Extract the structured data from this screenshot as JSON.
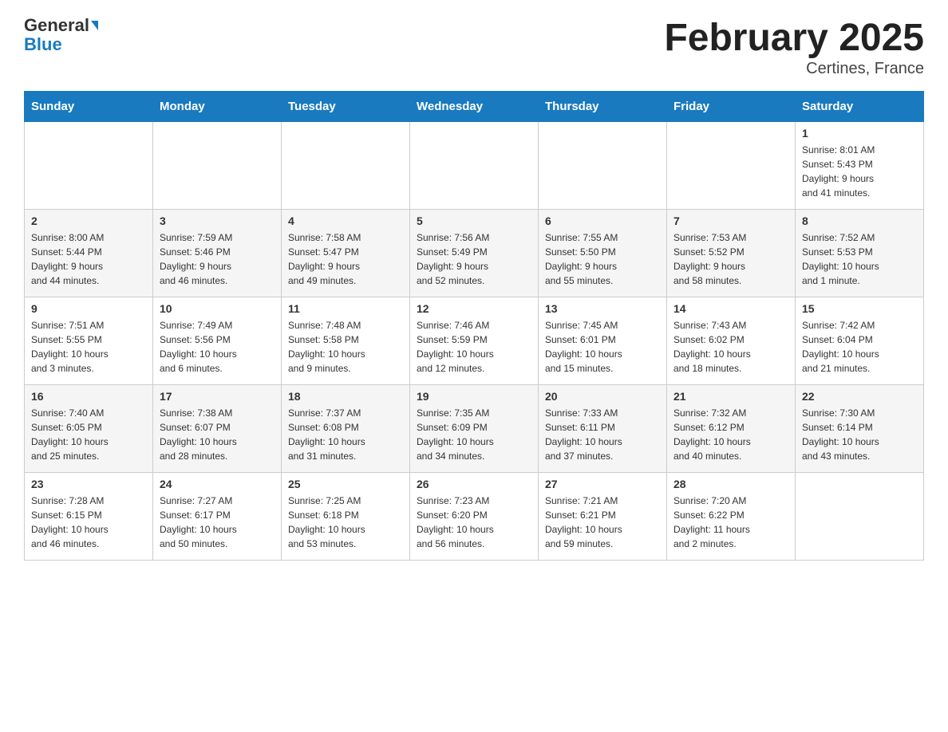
{
  "logo": {
    "text_general": "General",
    "text_blue": "Blue"
  },
  "title": "February 2025",
  "subtitle": "Certines, France",
  "weekdays": [
    "Sunday",
    "Monday",
    "Tuesday",
    "Wednesday",
    "Thursday",
    "Friday",
    "Saturday"
  ],
  "weeks": [
    [
      {
        "day": "",
        "info": ""
      },
      {
        "day": "",
        "info": ""
      },
      {
        "day": "",
        "info": ""
      },
      {
        "day": "",
        "info": ""
      },
      {
        "day": "",
        "info": ""
      },
      {
        "day": "",
        "info": ""
      },
      {
        "day": "1",
        "info": "Sunrise: 8:01 AM\nSunset: 5:43 PM\nDaylight: 9 hours\nand 41 minutes."
      }
    ],
    [
      {
        "day": "2",
        "info": "Sunrise: 8:00 AM\nSunset: 5:44 PM\nDaylight: 9 hours\nand 44 minutes."
      },
      {
        "day": "3",
        "info": "Sunrise: 7:59 AM\nSunset: 5:46 PM\nDaylight: 9 hours\nand 46 minutes."
      },
      {
        "day": "4",
        "info": "Sunrise: 7:58 AM\nSunset: 5:47 PM\nDaylight: 9 hours\nand 49 minutes."
      },
      {
        "day": "5",
        "info": "Sunrise: 7:56 AM\nSunset: 5:49 PM\nDaylight: 9 hours\nand 52 minutes."
      },
      {
        "day": "6",
        "info": "Sunrise: 7:55 AM\nSunset: 5:50 PM\nDaylight: 9 hours\nand 55 minutes."
      },
      {
        "day": "7",
        "info": "Sunrise: 7:53 AM\nSunset: 5:52 PM\nDaylight: 9 hours\nand 58 minutes."
      },
      {
        "day": "8",
        "info": "Sunrise: 7:52 AM\nSunset: 5:53 PM\nDaylight: 10 hours\nand 1 minute."
      }
    ],
    [
      {
        "day": "9",
        "info": "Sunrise: 7:51 AM\nSunset: 5:55 PM\nDaylight: 10 hours\nand 3 minutes."
      },
      {
        "day": "10",
        "info": "Sunrise: 7:49 AM\nSunset: 5:56 PM\nDaylight: 10 hours\nand 6 minutes."
      },
      {
        "day": "11",
        "info": "Sunrise: 7:48 AM\nSunset: 5:58 PM\nDaylight: 10 hours\nand 9 minutes."
      },
      {
        "day": "12",
        "info": "Sunrise: 7:46 AM\nSunset: 5:59 PM\nDaylight: 10 hours\nand 12 minutes."
      },
      {
        "day": "13",
        "info": "Sunrise: 7:45 AM\nSunset: 6:01 PM\nDaylight: 10 hours\nand 15 minutes."
      },
      {
        "day": "14",
        "info": "Sunrise: 7:43 AM\nSunset: 6:02 PM\nDaylight: 10 hours\nand 18 minutes."
      },
      {
        "day": "15",
        "info": "Sunrise: 7:42 AM\nSunset: 6:04 PM\nDaylight: 10 hours\nand 21 minutes."
      }
    ],
    [
      {
        "day": "16",
        "info": "Sunrise: 7:40 AM\nSunset: 6:05 PM\nDaylight: 10 hours\nand 25 minutes."
      },
      {
        "day": "17",
        "info": "Sunrise: 7:38 AM\nSunset: 6:07 PM\nDaylight: 10 hours\nand 28 minutes."
      },
      {
        "day": "18",
        "info": "Sunrise: 7:37 AM\nSunset: 6:08 PM\nDaylight: 10 hours\nand 31 minutes."
      },
      {
        "day": "19",
        "info": "Sunrise: 7:35 AM\nSunset: 6:09 PM\nDaylight: 10 hours\nand 34 minutes."
      },
      {
        "day": "20",
        "info": "Sunrise: 7:33 AM\nSunset: 6:11 PM\nDaylight: 10 hours\nand 37 minutes."
      },
      {
        "day": "21",
        "info": "Sunrise: 7:32 AM\nSunset: 6:12 PM\nDaylight: 10 hours\nand 40 minutes."
      },
      {
        "day": "22",
        "info": "Sunrise: 7:30 AM\nSunset: 6:14 PM\nDaylight: 10 hours\nand 43 minutes."
      }
    ],
    [
      {
        "day": "23",
        "info": "Sunrise: 7:28 AM\nSunset: 6:15 PM\nDaylight: 10 hours\nand 46 minutes."
      },
      {
        "day": "24",
        "info": "Sunrise: 7:27 AM\nSunset: 6:17 PM\nDaylight: 10 hours\nand 50 minutes."
      },
      {
        "day": "25",
        "info": "Sunrise: 7:25 AM\nSunset: 6:18 PM\nDaylight: 10 hours\nand 53 minutes."
      },
      {
        "day": "26",
        "info": "Sunrise: 7:23 AM\nSunset: 6:20 PM\nDaylight: 10 hours\nand 56 minutes."
      },
      {
        "day": "27",
        "info": "Sunrise: 7:21 AM\nSunset: 6:21 PM\nDaylight: 10 hours\nand 59 minutes."
      },
      {
        "day": "28",
        "info": "Sunrise: 7:20 AM\nSunset: 6:22 PM\nDaylight: 11 hours\nand 2 minutes."
      },
      {
        "day": "",
        "info": ""
      }
    ]
  ]
}
